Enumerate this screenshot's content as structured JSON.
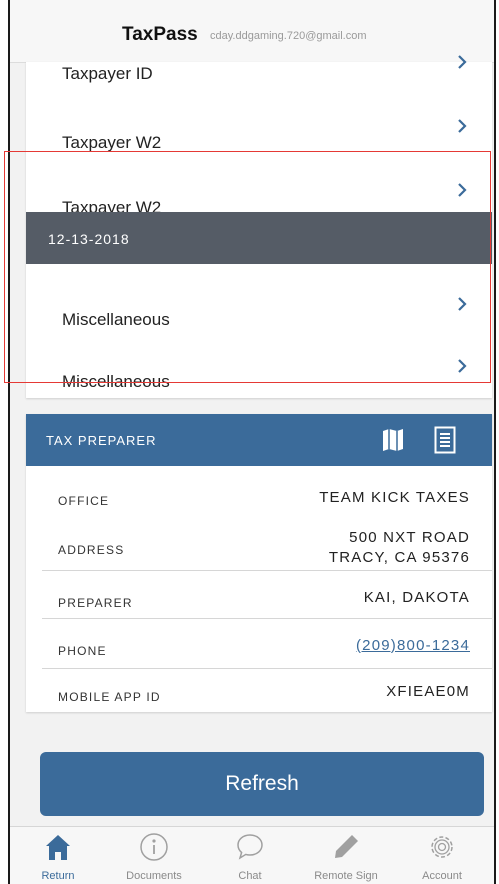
{
  "app": {
    "title": "TaxPass",
    "email": "cday.ddgaming.720@gmail.com"
  },
  "documents": [
    {
      "label": "Taxpayer ID"
    },
    {
      "label": "Taxpayer W2"
    },
    {
      "label": "Taxpayer W2"
    }
  ],
  "date_group": {
    "date": "12-13-2018",
    "items": [
      {
        "label": "Miscellaneous"
      },
      {
        "label": "Miscellaneous"
      }
    ]
  },
  "preparer": {
    "header": "TAX PREPARER",
    "office_label": "OFFICE",
    "office_value": "TEAM KICK TAXES",
    "address_label": "ADDRESS",
    "address_line1": "500 NXT ROAD",
    "address_line2": "TRACY, CA 95376",
    "preparer_label": "PREPARER",
    "preparer_value": "KAI, DAKOTA",
    "phone_label": "PHONE",
    "phone_value": "(209)800-1234",
    "appid_label": "MOBILE APP ID",
    "appid_value": "XFIEAE0M"
  },
  "refresh_label": "Refresh",
  "tabs": [
    {
      "label": "Return",
      "icon": "home-icon"
    },
    {
      "label": "Documents",
      "icon": "info-icon"
    },
    {
      "label": "Chat",
      "icon": "chat-icon"
    },
    {
      "label": "Remote Sign",
      "icon": "pencil-icon"
    },
    {
      "label": "Account",
      "icon": "gear-icon"
    }
  ],
  "colors": {
    "accent": "#3b6b9a",
    "date_bar": "#555c66",
    "highlight": "#e53935"
  }
}
